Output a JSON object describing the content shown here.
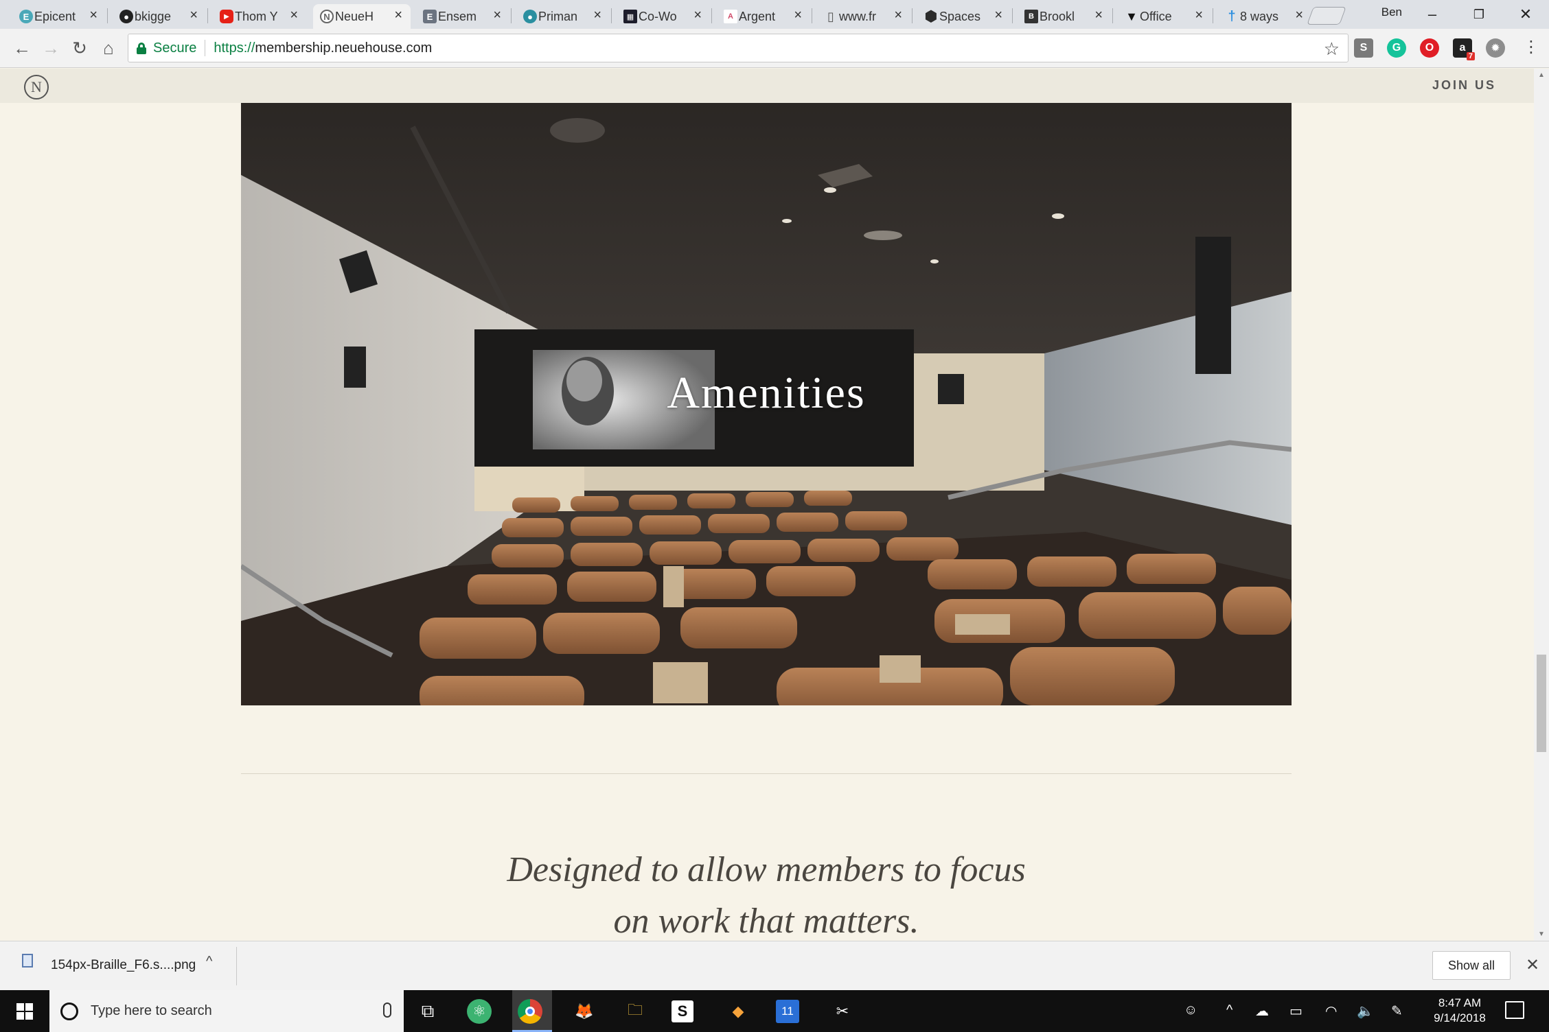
{
  "browser": {
    "tabs": [
      {
        "label": "Epicent",
        "icon": "epicenter-favicon",
        "color": "#4aa8b8",
        "glyph": "E"
      },
      {
        "label": "bkigge",
        "icon": "github-favicon",
        "color": "#222222",
        "glyph": "●"
      },
      {
        "label": "Thom Y",
        "icon": "youtube-favicon",
        "color": "#e62117",
        "glyph": "▶"
      },
      {
        "label": "NeueH",
        "icon": "neuehouse-favicon",
        "color": "#666666",
        "glyph": "N"
      },
      {
        "label": "Ensem",
        "icon": "ensemble-favicon",
        "color": "#6b7380",
        "glyph": "E"
      },
      {
        "label": "Priman",
        "icon": "primary-favicon",
        "color": "#2a8fa0",
        "glyph": "●"
      },
      {
        "label": "Co-Wo",
        "icon": "cowork-favicon",
        "color": "#1d1d2b",
        "glyph": "▦"
      },
      {
        "label": "Argent",
        "icon": "argent-favicon",
        "color": "#d04b6a",
        "glyph": "A"
      },
      {
        "label": "www.fr",
        "icon": "document-favicon",
        "color": "#9aa0a6",
        "glyph": "▯"
      },
      {
        "label": "Spaces",
        "icon": "spaces-favicon",
        "color": "#2b2b2b",
        "glyph": "⬢"
      },
      {
        "label": "Brookl",
        "icon": "brooklyn-favicon",
        "color": "#333333",
        "glyph": "B"
      },
      {
        "label": "Office",
        "icon": "office-favicon",
        "color": "#111111",
        "glyph": "▼"
      },
      {
        "label": "8 ways",
        "icon": "pin-favicon",
        "color": "#2c8fe0",
        "glyph": "†"
      }
    ],
    "profile_name": "Ben",
    "omnibox": {
      "secure_label": "Secure",
      "scheme": "https://",
      "host": "membership.neuehouse.com"
    },
    "extensions": [
      {
        "name": "ext-s-icon",
        "glyph": "S",
        "color": "#7a7a7a"
      },
      {
        "name": "grammarly-icon",
        "glyph": "G",
        "color": "#15c39a"
      },
      {
        "name": "opera-icon",
        "glyph": "O",
        "color": "#e01e26"
      },
      {
        "name": "amazon-icon",
        "glyph": "a",
        "color": "#222222",
        "badge": "7"
      },
      {
        "name": "gear-extension-icon",
        "glyph": "✹",
        "color": "#8d8d8d"
      }
    ]
  },
  "site": {
    "logo_letter": "N",
    "join_label": "JOIN US",
    "hero_title": "Amenities",
    "tagline_line1": "Designed to allow members to focus",
    "tagline_line2": "on work that matters."
  },
  "downloads": {
    "file_name": "154px-Braille_F6.s....png",
    "show_all_label": "Show all"
  },
  "taskbar": {
    "search_placeholder": "Type here to search",
    "calendar_day": "11",
    "time": "8:47 AM",
    "date": "9/14/2018"
  },
  "colors": {
    "page_bg": "#f7f3e8",
    "header_bg": "#ece9de",
    "secure_green": "#0b8043",
    "seat_brown": "#9b6a43"
  }
}
